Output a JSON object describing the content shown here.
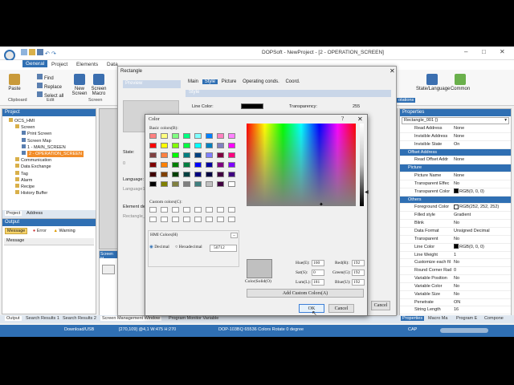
{
  "app": {
    "title": "DOPSoft - NewProject - [2 - OPERATION_SCREEN]",
    "ribbon_tabs": [
      "General",
      "Project",
      "Elements",
      "Data"
    ],
    "ribbon_groups": [
      "Clipboard",
      "Edit",
      "Screen"
    ],
    "buttons": {
      "paste": "Paste",
      "find": "Find",
      "replace": "Replace",
      "select_all": "Select all",
      "new_screen": "New Screen",
      "screen_macro": "Screen Macro",
      "state_language": "State/Language",
      "common": "Common",
      "rotations": "otations"
    }
  },
  "project_panel": {
    "title": "Project",
    "tree": [
      {
        "label": "OCS_HMI",
        "level": 0
      },
      {
        "label": "Screen",
        "level": 1
      },
      {
        "label": "Print Screen",
        "level": 2
      },
      {
        "label": "Screen Map",
        "level": 2
      },
      {
        "label": "1 - MAIN_SCREEN",
        "level": 2
      },
      {
        "label": "2 - OPERATION_SCREEN",
        "level": 2,
        "selected": true
      },
      {
        "label": "Communication",
        "level": 1
      },
      {
        "label": "Data Exchange",
        "level": 1
      },
      {
        "label": "Tag",
        "level": 1
      },
      {
        "label": "Alarm",
        "level": 1
      },
      {
        "label": "Recipe",
        "level": 1
      },
      {
        "label": "History Buffer",
        "level": 1
      }
    ],
    "tabs": [
      "Project",
      "Address"
    ]
  },
  "output_panel": {
    "title": "Output",
    "filters": [
      "Message",
      "Error",
      "Warning"
    ],
    "column": "Message",
    "tabs": [
      "Output",
      "Search Results 1",
      "Search Results 2"
    ]
  },
  "screen_mgmt": {
    "label": "Screen M",
    "tabs": [
      "Screen Management Window",
      "Program Monitor Variable"
    ]
  },
  "rect_dialog": {
    "title": "Rectangle",
    "preview": "Preview",
    "tabs": [
      "Main",
      "Style",
      "Picture",
      "Operating conds.",
      "Coord."
    ],
    "active_tab": "Style",
    "section": "Style",
    "line_color_label": "Line Color:",
    "transparency_label": "Transparency:",
    "transparency_value": "255",
    "state_label": "State:",
    "state_value": "0",
    "language_label": "Language:",
    "language_value": "Language1",
    "element_label": "Element des",
    "element_value": "Rectangle_",
    "ok": "OK",
    "cancel": "Cancel"
  },
  "color_dialog": {
    "title": "Color",
    "basic_colors_label": "Basic colors(B):",
    "basic_colors": [
      "#ff8080",
      "#ffff80",
      "#80ff80",
      "#00ff80",
      "#80ffff",
      "#0080ff",
      "#ff80c0",
      "#ff80ff",
      "#ff0000",
      "#ffff00",
      "#80ff00",
      "#00ff40",
      "#00ffff",
      "#0080c0",
      "#8080c0",
      "#ff00ff",
      "#804040",
      "#ff8040",
      "#00ff00",
      "#008080",
      "#004080",
      "#8080ff",
      "#800040",
      "#ff0080",
      "#800000",
      "#ff8000",
      "#008000",
      "#008040",
      "#0000ff",
      "#0000a0",
      "#800080",
      "#8000ff",
      "#400000",
      "#804000",
      "#004000",
      "#004040",
      "#000080",
      "#000040",
      "#400040",
      "#400080",
      "#000000",
      "#808000",
      "#808040",
      "#808080",
      "#408080",
      "#c0c0c0",
      "#400040",
      "#ffffff"
    ],
    "custom_colors_label": "Custom colors(C):",
    "hmi_colors_label": "HMI Colors(H)",
    "radio_decimal": "Decimal",
    "radio_hex": "Hexadecimal",
    "hmi_value": "50712",
    "solid_label": "Color|Solid(O)",
    "hue_label": "Hue(E):",
    "hue": "160",
    "sat_label": "Sat(S):",
    "sat": "0",
    "lum_label": "Lum(L):",
    "lum": "181",
    "red_label": "Red(R):",
    "red": "192",
    "green_label": "Green(G):",
    "green": "192",
    "blue_label": "Blue(U):",
    "blue": "192",
    "add_custom": "Add Custom Colors(A)",
    "ok": "OK",
    "cancel": "Cancel",
    "help": "?",
    "current_color": "#c0c0c0"
  },
  "properties": {
    "title": "Properties",
    "object": "Rectangle_001 ()",
    "rows": [
      {
        "k": "Read Address",
        "v": "None"
      },
      {
        "k": "Invisible Address",
        "v": "None"
      },
      {
        "k": "Invisible State",
        "v": "On"
      },
      {
        "section": "Offset Address"
      },
      {
        "k": "Read Offset Addr",
        "v": "None"
      },
      {
        "section": "Picture"
      },
      {
        "k": "Picture Name",
        "v": "None"
      },
      {
        "k": "Transparent Effec",
        "v": "No"
      },
      {
        "k": "Transparent Color",
        "v": "RGB(0, 0, 0)",
        "color": "#000000"
      },
      {
        "section": "Others"
      },
      {
        "k": "Foreground Color",
        "v": "RGB(252, 252, 252)",
        "color": "#fcfcfc"
      },
      {
        "k": "Filled style",
        "v": "Gradient"
      },
      {
        "k": "Blink",
        "v": "No"
      },
      {
        "k": "Data Format",
        "v": "Unsigned Decimal"
      },
      {
        "k": "Transparent",
        "v": "No"
      },
      {
        "k": "Line Color",
        "v": "RGB(0, 0, 0)",
        "color": "#000000"
      },
      {
        "k": "Line Weight",
        "v": "1"
      },
      {
        "k": "Customize each fil",
        "v": "No"
      },
      {
        "k": "Round Corner Rad",
        "v": "0"
      },
      {
        "k": "Variable Position",
        "v": "No"
      },
      {
        "k": "Variable Color",
        "v": "No"
      },
      {
        "k": "Variable Size",
        "v": "No"
      },
      {
        "k": "Penetrate",
        "v": "ON"
      },
      {
        "k": "String Length",
        "v": "16"
      }
    ],
    "tabs": [
      "Properties",
      "Macro Ma",
      "Program E",
      "Compone"
    ]
  },
  "statusbar": {
    "download": "Download/USB",
    "coords": "[270,109] @4,1 W:475 H:270",
    "device": "DOP-103BQ 65536 Colors Rotate 0 degree",
    "cap": "CAP"
  }
}
